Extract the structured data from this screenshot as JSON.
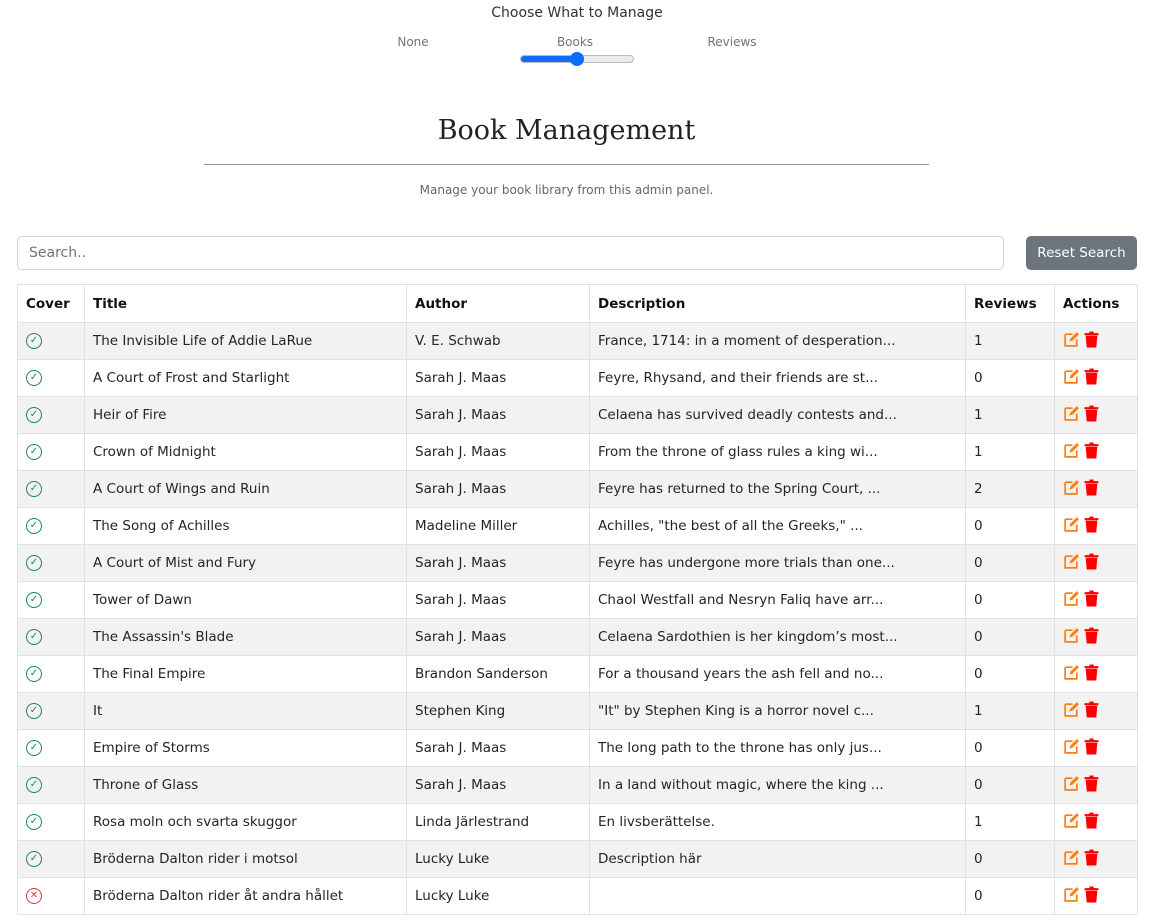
{
  "switcher": {
    "title": "Choose What to Manage",
    "options": [
      "None",
      "Books",
      "Reviews"
    ],
    "selected": "Books",
    "level": 0.5
  },
  "header": {
    "title": "Book Management",
    "subtitle": "Manage your book library from this admin panel."
  },
  "search": {
    "placeholder": "Search..",
    "reset_label": "Reset Search"
  },
  "table": {
    "columns": [
      "Cover",
      "Title",
      "Author",
      "Description",
      "Reviews",
      "Actions"
    ],
    "rows": [
      {
        "cover": "ok",
        "title": "The Invisible Life of Addie LaRue",
        "author": "V. E. Schwab",
        "description": "France, 1714: in a moment of desperation...",
        "reviews": "1"
      },
      {
        "cover": "ok",
        "title": "A Court of Frost and Starlight",
        "author": "Sarah J. Maas",
        "description": "Feyre, Rhysand, and their friends are st...",
        "reviews": "0"
      },
      {
        "cover": "ok",
        "title": "Heir of Fire",
        "author": "Sarah J. Maas",
        "description": "Celaena has survived deadly contests and...",
        "reviews": "1"
      },
      {
        "cover": "ok",
        "title": "Crown of Midnight",
        "author": "Sarah J. Maas",
        "description": "From the throne of glass rules a king wi...",
        "reviews": "1"
      },
      {
        "cover": "ok",
        "title": "A Court of Wings and Ruin",
        "author": "Sarah J. Maas",
        "description": "Feyre has returned to the Spring Court, ...",
        "reviews": "2"
      },
      {
        "cover": "ok",
        "title": "The Song of Achilles",
        "author": "Madeline Miller",
        "description": "Achilles, \"the best of all the Greeks,\" ...",
        "reviews": "0"
      },
      {
        "cover": "ok",
        "title": "A Court of Mist and Fury",
        "author": "Sarah J. Maas",
        "description": "Feyre has undergone more trials than one...",
        "reviews": "0"
      },
      {
        "cover": "ok",
        "title": "Tower of Dawn",
        "author": "Sarah J. Maas",
        "description": "Chaol Westfall and Nesryn Faliq have arr...",
        "reviews": "0"
      },
      {
        "cover": "ok",
        "title": "The Assassin's Blade",
        "author": "Sarah J. Maas",
        "description": "Celaena Sardothien is her kingdom’s most...",
        "reviews": "0"
      },
      {
        "cover": "ok",
        "title": "The Final Empire",
        "author": "Brandon Sanderson",
        "description": "For a thousand years the ash fell and no...",
        "reviews": "0"
      },
      {
        "cover": "ok",
        "title": "It",
        "author": "Stephen King",
        "description": "\"It\" by Stephen King is a horror novel c...",
        "reviews": "1"
      },
      {
        "cover": "ok",
        "title": "Empire of Storms",
        "author": "Sarah J. Maas",
        "description": "The long path to the throne has only jus...",
        "reviews": "0"
      },
      {
        "cover": "ok",
        "title": "Throne of Glass",
        "author": "Sarah J. Maas",
        "description": "In a land without magic, where the king ...",
        "reviews": "0"
      },
      {
        "cover": "ok",
        "title": "Rosa moln och svarta skuggor",
        "author": "Linda Järlestrand",
        "description": "En livsberättelse.",
        "reviews": "1"
      },
      {
        "cover": "ok",
        "title": "Bröderna Dalton rider i motsol",
        "author": "Lucky Luke",
        "description": "Description här",
        "reviews": "0"
      },
      {
        "cover": "missing",
        "title": "Bröderna Dalton rider åt andra hållet",
        "author": "Lucky Luke",
        "description": "",
        "reviews": "0"
      }
    ]
  },
  "icons": {
    "cover_ok": "check-circle-icon",
    "cover_missing": "x-circle-icon",
    "edit": "edit-icon",
    "delete": "trash-icon"
  },
  "colors": {
    "ok": "#198754",
    "missing": "#dc3545",
    "edit": "#fd7e14",
    "delete": "#ff0000",
    "slider": "#0d6efd",
    "reset_button": "#6c757d"
  }
}
